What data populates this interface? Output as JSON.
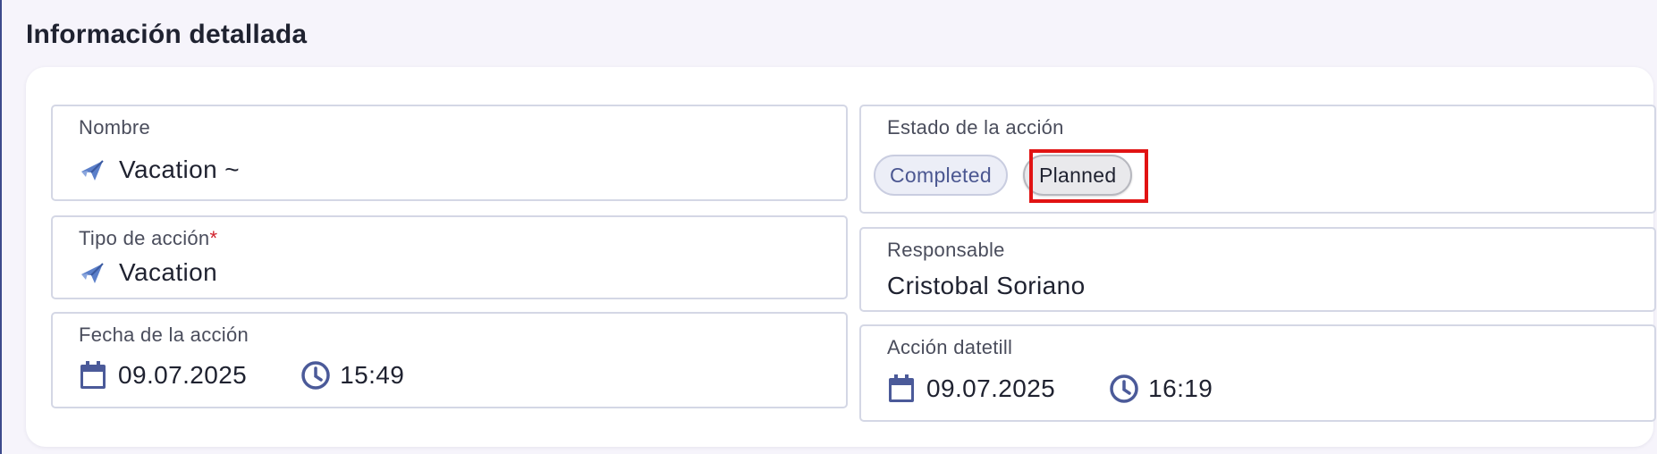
{
  "section": {
    "title": "Información detallada"
  },
  "fields": {
    "nombre": {
      "label": "Nombre",
      "value": "Vacation ~",
      "icon": "airplane-icon"
    },
    "tipo": {
      "label": "Tipo de acción",
      "required_mark": "*",
      "value": "Vacation",
      "icon": "airplane-icon"
    },
    "fecha": {
      "label": "Fecha de la acción",
      "date": "09.07.2025",
      "time": "15:49"
    },
    "estado": {
      "label": "Estado de la acción",
      "options": [
        "Completed",
        "Planned"
      ],
      "selected": "Planned"
    },
    "responsable": {
      "label": "Responsable",
      "value": "Cristobal Soriano"
    },
    "datetill": {
      "label": "Acción datetill",
      "date": "09.07.2025",
      "time": "16:19"
    }
  },
  "colors": {
    "accent": "#3d4a8c",
    "required": "#d0202a",
    "highlight": "#e11313"
  }
}
